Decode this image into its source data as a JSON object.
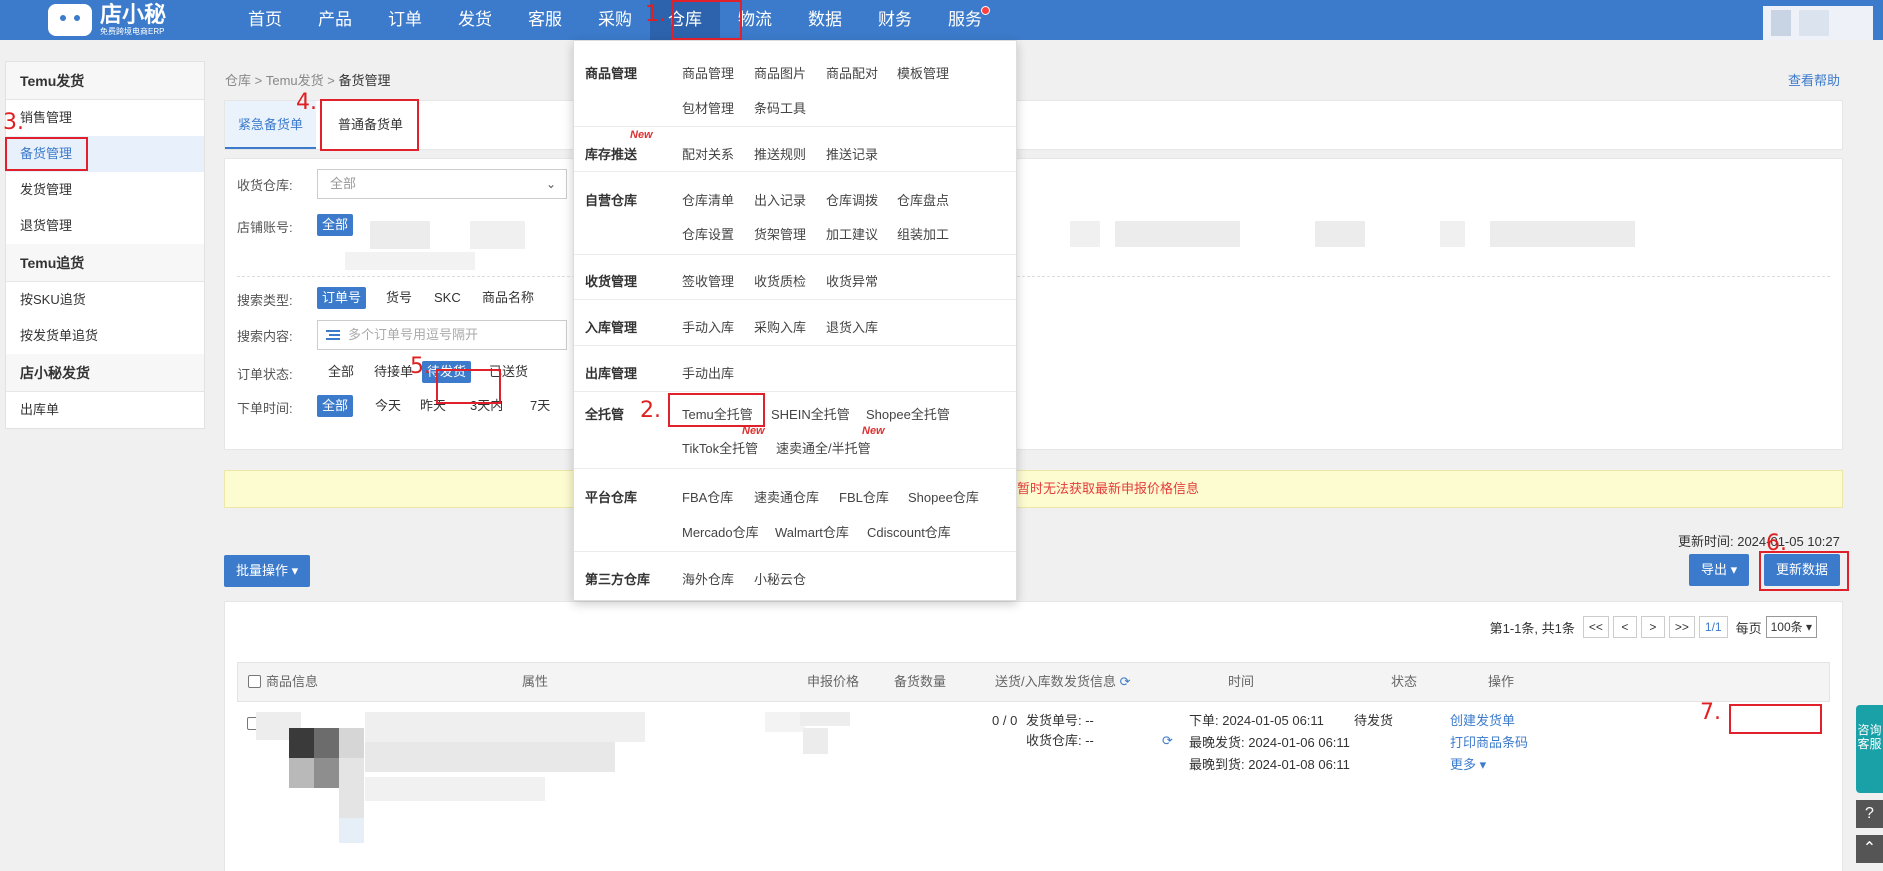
{
  "logo": {
    "name": "店小秘",
    "sub": "免费跨境电商ERP"
  },
  "nav": [
    "首页",
    "产品",
    "订单",
    "发货",
    "客服",
    "采购",
    "仓库",
    "物流",
    "数据",
    "财务",
    "服务"
  ],
  "sidebar": {
    "groups": [
      {
        "title": "Temu发货",
        "items": [
          "销售管理",
          "备货管理",
          "发货管理",
          "退货管理"
        ]
      },
      {
        "title": "Temu追货",
        "items": [
          "按SKU追货",
          "按发货单追货"
        ]
      },
      {
        "title": "店小秘发货",
        "items": [
          "出库单"
        ]
      }
    ]
  },
  "breadcrumb": {
    "a": "仓库",
    "b": "Temu发货",
    "c": "备货管理"
  },
  "help": "查看帮助",
  "tabs": [
    "紧急备货单",
    "普通备货单"
  ],
  "filters": {
    "warehouse_label": "收货仓库:",
    "warehouse_value": "全部",
    "shop_label": "店铺账号:",
    "shop_all": "全部",
    "search_type_label": "搜索类型:",
    "search_types": [
      "订单号",
      "货号",
      "SKC",
      "商品名称"
    ],
    "search_content_label": "搜索内容:",
    "search_placeholder": "多个订单号用逗号隔开",
    "status_label": "订单状态:",
    "statuses": [
      "全部",
      "待接单",
      "待发货",
      "已送货"
    ],
    "time_label": "下单时间:",
    "times": [
      "全部",
      "今天",
      "昨天",
      "3天内",
      "7天"
    ]
  },
  "notice": "暂时无法获取最新申报价格信息",
  "update_time": "更新时间: 2024-01-05 10:27",
  "actions": {
    "batch": "批量操作",
    "export": "导出",
    "refresh": "更新数据"
  },
  "pager": {
    "summary": "第1-1条, 共1条",
    "first": "<<",
    "prev": "<",
    "next": ">",
    "last": ">>",
    "current": "1/1",
    "per_label": "每页",
    "per_value": "100条"
  },
  "table": {
    "headers": [
      "商品信息",
      "属性",
      "申报价格",
      "备货数量",
      "送货/入库数",
      "发货信息",
      "时间",
      "状态",
      "操作"
    ],
    "row": {
      "qty": "0 / 0",
      "ship_no": "发货单号: --",
      "recv_wh": "收货仓库: --",
      "order_time": "下单: 2024-01-05 06:11",
      "latest_ship": "最晚发货: 2024-01-06 06:11",
      "latest_arrive": "最晚到货: 2024-01-08 06:11",
      "status": "待发货",
      "op_create": "创建发货单",
      "op_print": "打印商品条码",
      "op_more": "更多"
    }
  },
  "mega_menu": [
    {
      "title": "商品管理",
      "links": [
        "商品管理",
        "商品图片",
        "商品配对",
        "模板管理",
        "包材管理",
        "条码工具"
      ]
    },
    {
      "title": "库存推送",
      "links": [
        "配对关系",
        "推送规则",
        "推送记录"
      ],
      "new": "New"
    },
    {
      "title": "自营仓库",
      "links": [
        "仓库清单",
        "出入记录",
        "仓库调拨",
        "仓库盘点",
        "仓库设置",
        "货架管理",
        "加工建议",
        "组装加工"
      ]
    },
    {
      "title": "收货管理",
      "links": [
        "签收管理",
        "收货质检",
        "收货异常"
      ]
    },
    {
      "title": "入库管理",
      "links": [
        "手动入库",
        "采购入库",
        "退货入库"
      ]
    },
    {
      "title": "出库管理",
      "links": [
        "手动出库"
      ]
    },
    {
      "title": "全托管",
      "links": [
        "Temu全托管",
        "SHEIN全托管",
        "Shopee全托管",
        "TikTok全托管",
        "速卖通全/半托管"
      ],
      "new": "New"
    },
    {
      "title": "平台仓库",
      "links": [
        "FBA仓库",
        "速卖通仓库",
        "FBL仓库",
        "Shopee仓库",
        "Mercado仓库",
        "Walmart仓库",
        "Cdiscount仓库"
      ]
    },
    {
      "title": "第三方仓库",
      "links": [
        "海外仓库",
        "小秘云仓"
      ]
    }
  ],
  "annotations": [
    "1.",
    "2.",
    "3.",
    "4.",
    "5.",
    "6.",
    "7."
  ],
  "consult": "咨询客服",
  "icons": {
    "refresh": "refresh-icon",
    "help": "help-icon",
    "top": "back-to-top-icon"
  },
  "colors": {
    "brand": "#3c7bcb",
    "annotation": "#e0202a",
    "notice_bg": "#fdfbd0"
  }
}
